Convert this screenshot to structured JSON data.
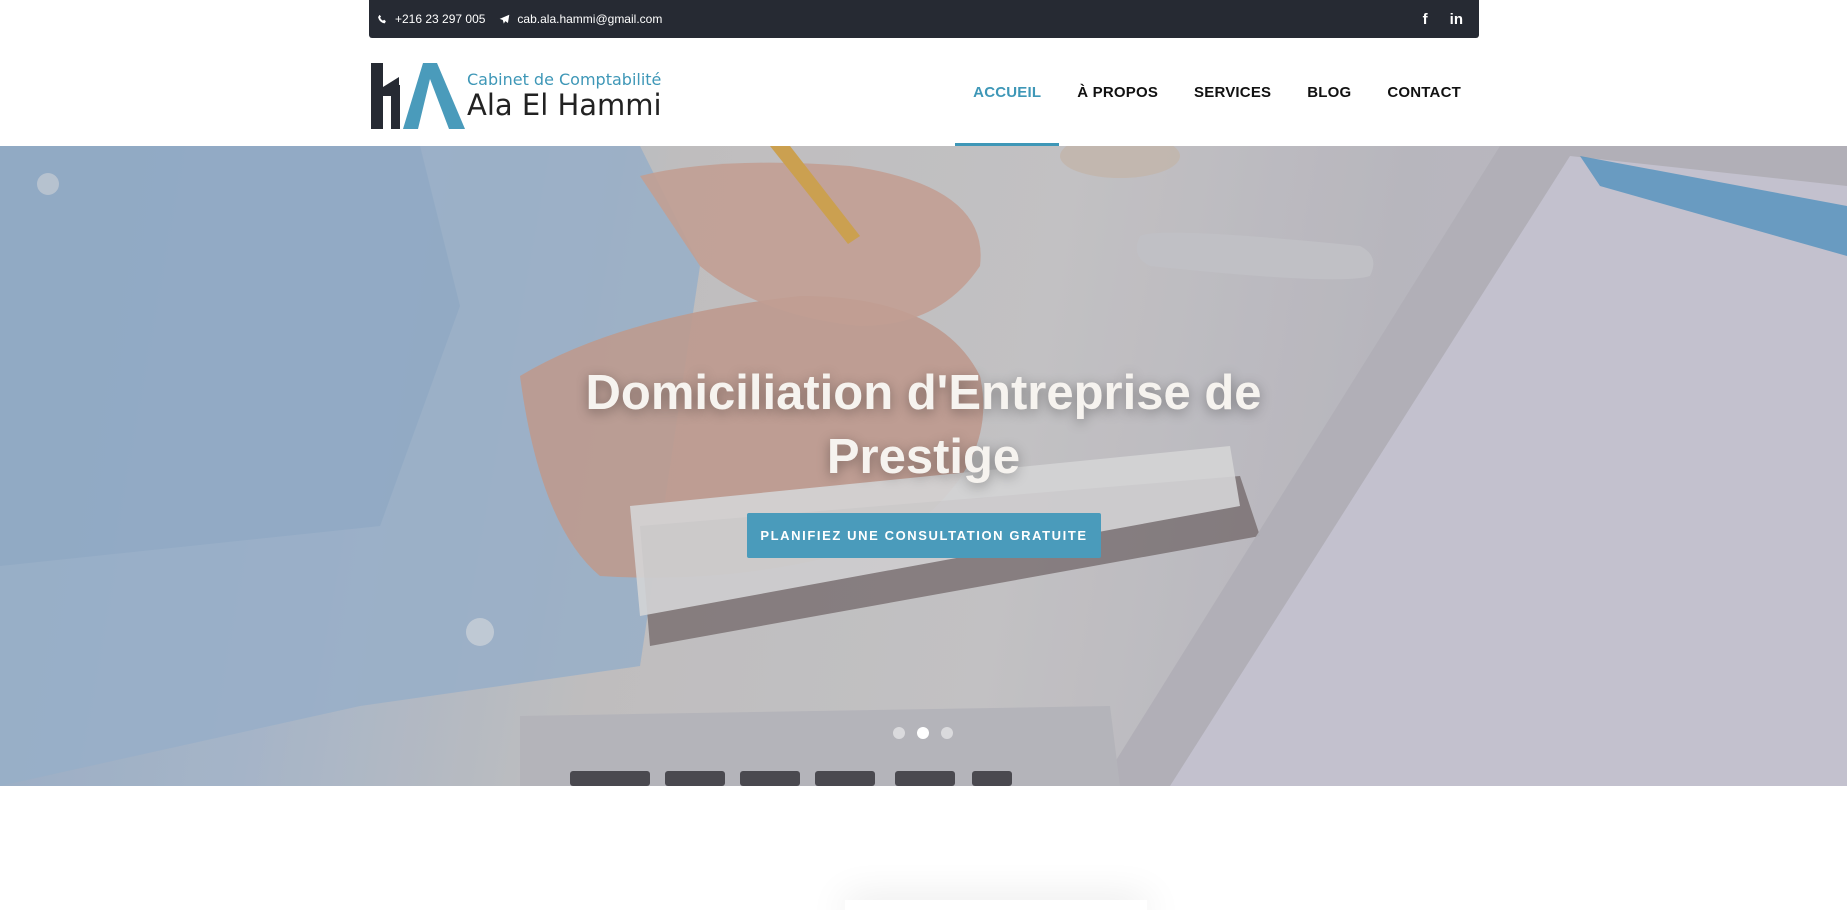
{
  "topbar": {
    "phone": "+216 23 297 005",
    "email": "cab.ala.hammi@gmail.com",
    "phone_icon": "phone-icon",
    "email_icon": "paper-plane-icon",
    "social": [
      {
        "icon": "facebook-icon",
        "glyph": "f"
      },
      {
        "icon": "linkedin-icon",
        "glyph": "in"
      }
    ]
  },
  "brand": {
    "tagline": "Cabinet de Comptabilité",
    "name": "Ala El Hammi",
    "accent_color": "#3e97b7",
    "dark_color": "#262a33"
  },
  "nav": {
    "items": [
      {
        "label": "ACCUEIL",
        "active": true
      },
      {
        "label": "À PROPOS",
        "active": false
      },
      {
        "label": "SERVICES",
        "active": false
      },
      {
        "label": "BLOG",
        "active": false
      },
      {
        "label": "CONTACT",
        "active": false
      }
    ]
  },
  "hero": {
    "title_line1": "Domiciliation d'Entreprise de",
    "title_line2": "Prestige",
    "cta_label": "PLANIFIEZ UNE CONSULTATION GRATUITE",
    "slides_total": 3,
    "slide_active": 2
  }
}
